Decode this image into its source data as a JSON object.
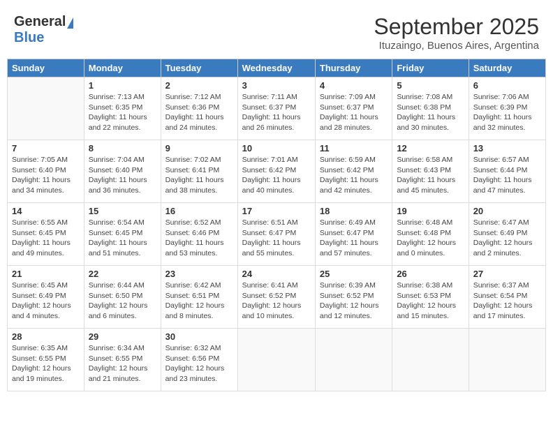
{
  "header": {
    "logo_general": "General",
    "logo_blue": "Blue",
    "title": "September 2025",
    "location": "Ituzaingo, Buenos Aires, Argentina"
  },
  "weekdays": [
    "Sunday",
    "Monday",
    "Tuesday",
    "Wednesday",
    "Thursday",
    "Friday",
    "Saturday"
  ],
  "weeks": [
    [
      {
        "day": "",
        "info": ""
      },
      {
        "day": "1",
        "info": "Sunrise: 7:13 AM\nSunset: 6:35 PM\nDaylight: 11 hours\nand 22 minutes."
      },
      {
        "day": "2",
        "info": "Sunrise: 7:12 AM\nSunset: 6:36 PM\nDaylight: 11 hours\nand 24 minutes."
      },
      {
        "day": "3",
        "info": "Sunrise: 7:11 AM\nSunset: 6:37 PM\nDaylight: 11 hours\nand 26 minutes."
      },
      {
        "day": "4",
        "info": "Sunrise: 7:09 AM\nSunset: 6:37 PM\nDaylight: 11 hours\nand 28 minutes."
      },
      {
        "day": "5",
        "info": "Sunrise: 7:08 AM\nSunset: 6:38 PM\nDaylight: 11 hours\nand 30 minutes."
      },
      {
        "day": "6",
        "info": "Sunrise: 7:06 AM\nSunset: 6:39 PM\nDaylight: 11 hours\nand 32 minutes."
      }
    ],
    [
      {
        "day": "7",
        "info": "Sunrise: 7:05 AM\nSunset: 6:40 PM\nDaylight: 11 hours\nand 34 minutes."
      },
      {
        "day": "8",
        "info": "Sunrise: 7:04 AM\nSunset: 6:40 PM\nDaylight: 11 hours\nand 36 minutes."
      },
      {
        "day": "9",
        "info": "Sunrise: 7:02 AM\nSunset: 6:41 PM\nDaylight: 11 hours\nand 38 minutes."
      },
      {
        "day": "10",
        "info": "Sunrise: 7:01 AM\nSunset: 6:42 PM\nDaylight: 11 hours\nand 40 minutes."
      },
      {
        "day": "11",
        "info": "Sunrise: 6:59 AM\nSunset: 6:42 PM\nDaylight: 11 hours\nand 42 minutes."
      },
      {
        "day": "12",
        "info": "Sunrise: 6:58 AM\nSunset: 6:43 PM\nDaylight: 11 hours\nand 45 minutes."
      },
      {
        "day": "13",
        "info": "Sunrise: 6:57 AM\nSunset: 6:44 PM\nDaylight: 11 hours\nand 47 minutes."
      }
    ],
    [
      {
        "day": "14",
        "info": "Sunrise: 6:55 AM\nSunset: 6:45 PM\nDaylight: 11 hours\nand 49 minutes."
      },
      {
        "day": "15",
        "info": "Sunrise: 6:54 AM\nSunset: 6:45 PM\nDaylight: 11 hours\nand 51 minutes."
      },
      {
        "day": "16",
        "info": "Sunrise: 6:52 AM\nSunset: 6:46 PM\nDaylight: 11 hours\nand 53 minutes."
      },
      {
        "day": "17",
        "info": "Sunrise: 6:51 AM\nSunset: 6:47 PM\nDaylight: 11 hours\nand 55 minutes."
      },
      {
        "day": "18",
        "info": "Sunrise: 6:49 AM\nSunset: 6:47 PM\nDaylight: 11 hours\nand 57 minutes."
      },
      {
        "day": "19",
        "info": "Sunrise: 6:48 AM\nSunset: 6:48 PM\nDaylight: 12 hours\nand 0 minutes."
      },
      {
        "day": "20",
        "info": "Sunrise: 6:47 AM\nSunset: 6:49 PM\nDaylight: 12 hours\nand 2 minutes."
      }
    ],
    [
      {
        "day": "21",
        "info": "Sunrise: 6:45 AM\nSunset: 6:49 PM\nDaylight: 12 hours\nand 4 minutes."
      },
      {
        "day": "22",
        "info": "Sunrise: 6:44 AM\nSunset: 6:50 PM\nDaylight: 12 hours\nand 6 minutes."
      },
      {
        "day": "23",
        "info": "Sunrise: 6:42 AM\nSunset: 6:51 PM\nDaylight: 12 hours\nand 8 minutes."
      },
      {
        "day": "24",
        "info": "Sunrise: 6:41 AM\nSunset: 6:52 PM\nDaylight: 12 hours\nand 10 minutes."
      },
      {
        "day": "25",
        "info": "Sunrise: 6:39 AM\nSunset: 6:52 PM\nDaylight: 12 hours\nand 12 minutes."
      },
      {
        "day": "26",
        "info": "Sunrise: 6:38 AM\nSunset: 6:53 PM\nDaylight: 12 hours\nand 15 minutes."
      },
      {
        "day": "27",
        "info": "Sunrise: 6:37 AM\nSunset: 6:54 PM\nDaylight: 12 hours\nand 17 minutes."
      }
    ],
    [
      {
        "day": "28",
        "info": "Sunrise: 6:35 AM\nSunset: 6:55 PM\nDaylight: 12 hours\nand 19 minutes."
      },
      {
        "day": "29",
        "info": "Sunrise: 6:34 AM\nSunset: 6:55 PM\nDaylight: 12 hours\nand 21 minutes."
      },
      {
        "day": "30",
        "info": "Sunrise: 6:32 AM\nSunset: 6:56 PM\nDaylight: 12 hours\nand 23 minutes."
      },
      {
        "day": "",
        "info": ""
      },
      {
        "day": "",
        "info": ""
      },
      {
        "day": "",
        "info": ""
      },
      {
        "day": "",
        "info": ""
      }
    ]
  ]
}
